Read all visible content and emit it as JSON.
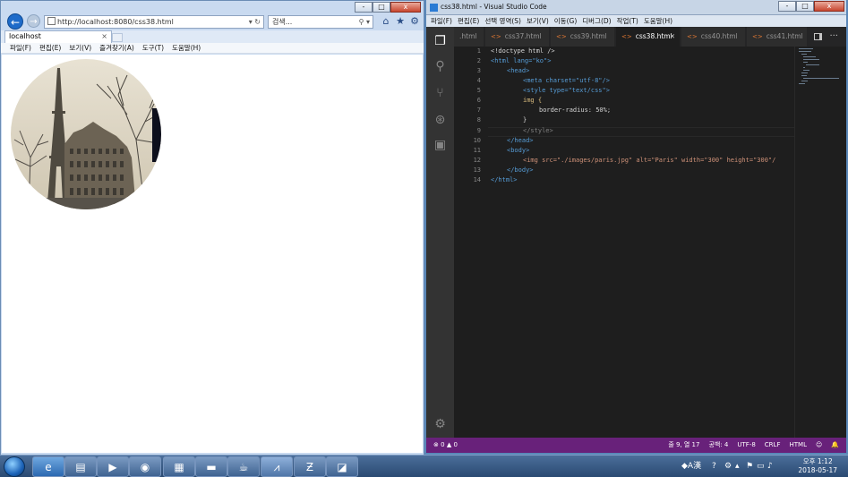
{
  "ie": {
    "address": "http://localhost:8080/css38.html",
    "address_refresh_icon": "refresh-icon",
    "search_placeholder": "검색...",
    "tab_title": "localhost",
    "menu": [
      "파일(F)",
      "편집(E)",
      "보기(V)",
      "즐겨찾기(A)",
      "도구(T)",
      "도움말(H)"
    ],
    "caption_buttons": [
      "-",
      "□",
      "x"
    ],
    "image_alt": "Paris"
  },
  "vscode": {
    "title": "css38.html - Visual Studio Code",
    "menu": [
      "파일(F)",
      "편집(E)",
      "선택 영역(S)",
      "보기(V)",
      "이동(G)",
      "디버그(D)",
      "작업(T)",
      "도움말(H)"
    ],
    "tabs": [
      ".html",
      "css37.html",
      "css39.html",
      "css38.html",
      "css40.html",
      "css41.html"
    ],
    "active_tab": "css38.html",
    "line_numbers": [
      "1",
      "2",
      "3",
      "4",
      "5",
      "6",
      "7",
      "8",
      "9",
      "10",
      "11",
      "12",
      "13",
      "14"
    ],
    "status": {
      "errors": "0",
      "warnings": "0",
      "position": "줄 9, 열 17",
      "spaces": "공백: 4",
      "encoding": "UTF-8",
      "eol": "CRLF",
      "language": "HTML"
    },
    "accent_color": "#68217a"
  },
  "code_lines": [
    "<!doctype html />",
    "<html lang=\"ko\">",
    "<head>",
    "<meta charset=\"utf-8\"/>",
    "<style type=\"text/css\">",
    "img {",
    "border-radius: 50%;",
    "}",
    "</style>",
    "</head>",
    "<body>",
    "<img src=\"./images/paris.jpg\" alt=\"Paris\" width=\"300\" height=\"300\"/",
    "</body>",
    "</html>"
  ],
  "taskbar": {
    "apps": [
      "ie-icon",
      "explorer-icon",
      "media-player-icon",
      "chrome-icon",
      "powerpoint-icon",
      "cmd-icon",
      "java-icon",
      "vscode-icon",
      "filezilla-icon",
      "app-icon"
    ],
    "time": "오후 1:12",
    "date": "2018-05-17"
  }
}
